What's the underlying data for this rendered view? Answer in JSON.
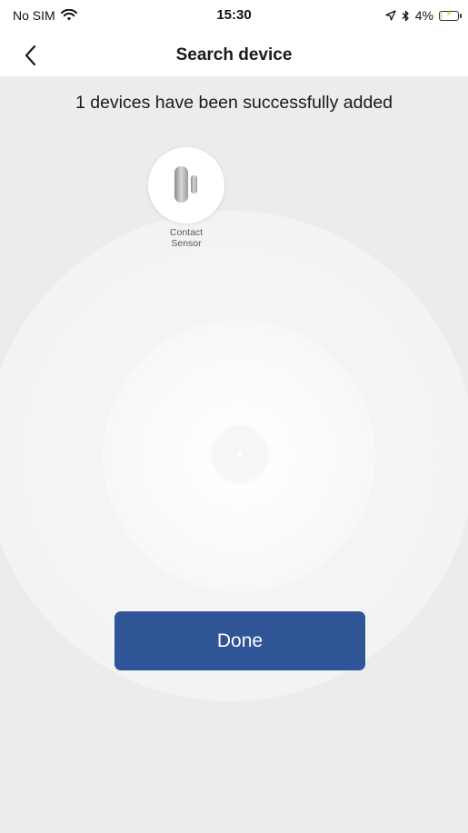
{
  "status_bar": {
    "carrier": "No SIM",
    "time": "15:30",
    "battery_percent": "4%",
    "battery_level": 0.04,
    "icons": [
      "wifi-icon",
      "location-icon",
      "bluetooth-icon",
      "battery-charging-icon"
    ]
  },
  "nav": {
    "title": "Search device",
    "back_icon": "chevron-left-icon"
  },
  "main": {
    "message": "1 devices have been successfully added",
    "devices": [
      {
        "name_line1": "Contact",
        "name_line2": "Sensor",
        "icon": "contact-sensor-icon"
      }
    ],
    "done_label": "Done"
  },
  "colors": {
    "accent": "#2f5597",
    "background": "#ececee",
    "battery_low": "#e0a800"
  }
}
